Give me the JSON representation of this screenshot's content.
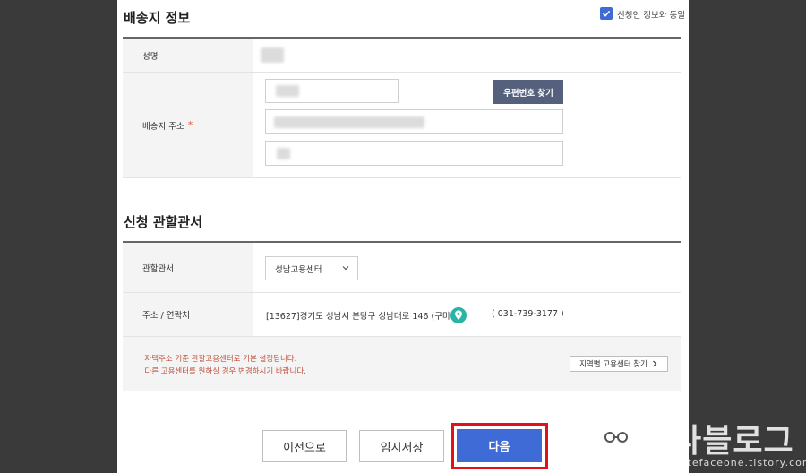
{
  "shipping": {
    "title": "배송지 정보",
    "same_as_applicant_label": "신청인 정보와 동일",
    "same_as_applicant_checked": true,
    "name_label": "성명",
    "address_label": "배송지 주소",
    "required_mark": "*",
    "zip_button": "우편번호 찾기"
  },
  "jurisdiction": {
    "title": "신청 관할관서",
    "office_label": "관할관서",
    "office_selected": "성남고용센터",
    "contact_label": "주소 / 연락처",
    "address": "[13627]경기도 성남시 분당구 성남대로 146 (구미동)",
    "phone": "( 031-739-3177 )",
    "notices": [
      "·  자택주소 기준 관할고용센터로 기본 설정됩니다.",
      "·  다른 고용센터를 원하실 경우 변경하시기 바랍니다."
    ],
    "region_button": "지역별 고용센터 찾기"
  },
  "footer": {
    "prev_button": "이전으로",
    "save_button": "임시저장",
    "next_button": "다음"
  },
  "watermark": {
    "text": "잼나블로그",
    "url": "www.whitefaceone.tistory.com"
  },
  "colors": {
    "primary": "#3e6bd6",
    "zip_button": "#55607c",
    "highlight": "#e3101a",
    "map_pin": "#2bb3a4",
    "notice_text": "#c0503a"
  },
  "icons": {
    "checkbox": "check-icon",
    "select": "chevron-down-icon",
    "map": "map-pin-icon",
    "region_button": "chevron-right-icon"
  }
}
